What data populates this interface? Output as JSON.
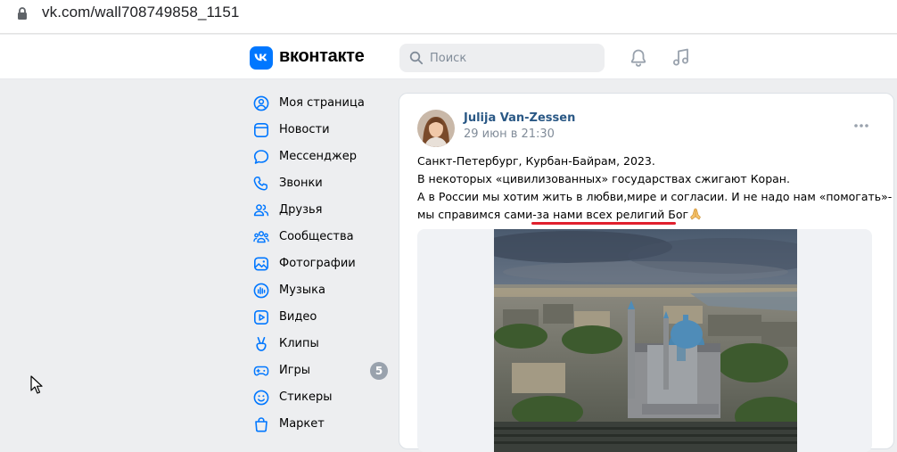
{
  "browser": {
    "url": "vk.com/wall708749858_1151"
  },
  "header": {
    "logo_text": "вконтакте",
    "search_placeholder": "Поиск"
  },
  "sidebar": {
    "items": [
      {
        "label": "Моя страница",
        "icon": "user-circle-icon"
      },
      {
        "label": "Новости",
        "icon": "news-icon"
      },
      {
        "label": "Мессенджер",
        "icon": "message-icon"
      },
      {
        "label": "Звонки",
        "icon": "phone-icon"
      },
      {
        "label": "Друзья",
        "icon": "friends-icon"
      },
      {
        "label": "Сообщества",
        "icon": "communities-icon"
      },
      {
        "label": "Фотографии",
        "icon": "photo-icon"
      },
      {
        "label": "Музыка",
        "icon": "music-bars-icon"
      },
      {
        "label": "Видео",
        "icon": "video-icon"
      },
      {
        "label": "Клипы",
        "icon": "clips-icon"
      },
      {
        "label": "Игры",
        "icon": "gamepad-icon",
        "badge": "5"
      },
      {
        "label": "Стикеры",
        "icon": "smile-icon"
      },
      {
        "label": "Маркет",
        "icon": "market-bag-icon"
      }
    ]
  },
  "post": {
    "author": "Julija Van-Zessen",
    "date": "29 июн в 21:30",
    "text_lines": [
      "Санкт-Петербург, Курбан-Байрам, 2023.",
      "В некоторых «цивилизованных» государствах сжигают Коран.",
      "А в России мы хотим жить в любви,мире и согласии. И не надо нам «помогать»-",
      "мы справимся сами-за нами всех религий Бог"
    ]
  },
  "colors": {
    "brand": "#0077ff",
    "author_link": "#2a5885",
    "page_bg": "#edeef0",
    "underline": "#e0202e"
  }
}
